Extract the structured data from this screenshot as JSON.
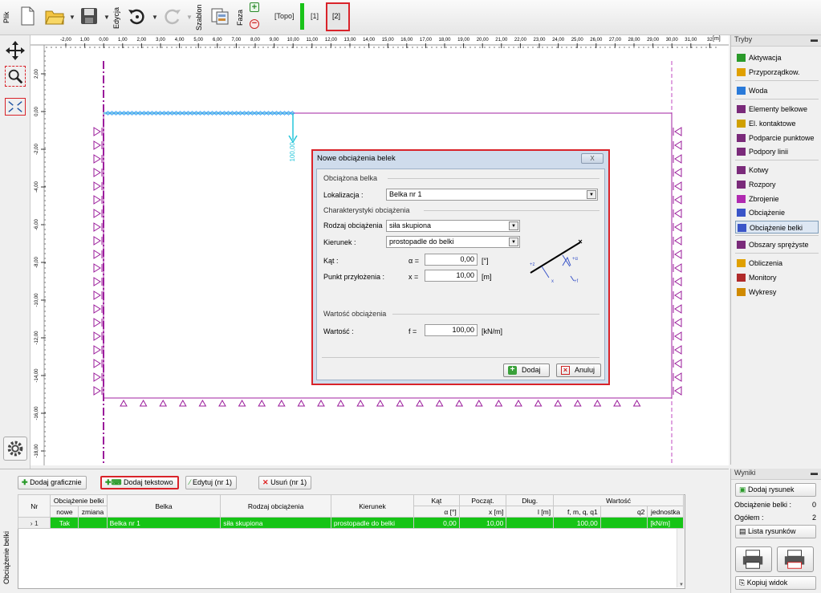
{
  "toolbar": {
    "plik": "Plik",
    "edycja": "Edycja",
    "szablon": "Szablon",
    "faza": "Faza",
    "stages": [
      "[Topo]",
      "[1]",
      "[2]"
    ]
  },
  "ruler": {
    "unit": "[m]",
    "xticks": [
      "-2,00",
      "1,00",
      "0,00",
      "1,00",
      "2,00",
      "3,00",
      "4,00",
      "5,00",
      "6,00",
      "7,00",
      "8,00",
      "9,00",
      "10,00",
      "11,00",
      "12,00",
      "13,00",
      "14,00",
      "15,00",
      "16,00",
      "17,00",
      "18,00",
      "19,00",
      "20,00",
      "21,00",
      "22,00",
      "23,00",
      "24,00",
      "25,00",
      "26,00",
      "27,00",
      "28,00",
      "29,00",
      "30,00",
      "31,00",
      "32"
    ],
    "yticks": [
      "2,00",
      "0,00",
      "-2,00",
      "-4,00",
      "-6,00",
      "-8,00",
      "-10,00",
      "-12,00",
      "-14,00",
      "-16,00",
      "-18,00"
    ]
  },
  "canvas": {
    "load_label": "100,00"
  },
  "right_panel": {
    "title": "Tryby",
    "items": [
      {
        "label": "Aktywacja",
        "icon": "activation-icon"
      },
      {
        "label": "Przyporządkow.",
        "icon": "assign-icon"
      },
      {
        "label": "Woda",
        "icon": "water-icon"
      },
      {
        "label": "Elementy belkowe",
        "icon": "beam-elements-icon"
      },
      {
        "label": "El. kontaktowe",
        "icon": "contact-elements-icon"
      },
      {
        "label": "Podparcie punktowe",
        "icon": "point-support-icon"
      },
      {
        "label": "Podpory linii",
        "icon": "line-support-icon"
      },
      {
        "label": "Kotwy",
        "icon": "anchors-icon"
      },
      {
        "label": "Rozpory",
        "icon": "struts-icon"
      },
      {
        "label": "Zbrojenie",
        "icon": "reinforcement-icon"
      },
      {
        "label": "Obciążenie",
        "icon": "load-icon"
      },
      {
        "label": "Obciążenie belki",
        "icon": "beam-load-icon"
      },
      {
        "label": "Obszary sprężyste",
        "icon": "elastic-areas-icon"
      },
      {
        "label": "Obliczenia",
        "icon": "calculation-icon"
      },
      {
        "label": "Monitory",
        "icon": "monitors-icon"
      },
      {
        "label": "Wykresy",
        "icon": "graphs-icon"
      }
    ]
  },
  "dialog": {
    "title": "Nowe obciążenia belek",
    "group1": "Obciążona belka",
    "lokalizacja_label": "Lokalizacja :",
    "lokalizacja_value": "Belka nr 1",
    "group2": "Charakterystyki obciążenia",
    "rodzaj_label": "Rodzaj obciążenia",
    "rodzaj_value": "siła skupiona",
    "kierunek_label": "Kierunek :",
    "kierunek_value": "prostopadle do belki",
    "kat_label": "Kąt :",
    "kat_sym": "α =",
    "kat_value": "0,00",
    "kat_unit": "[°]",
    "punkt_label": "Punkt przyłożenia :",
    "punkt_sym": "x =",
    "punkt_value": "10,00",
    "punkt_unit": "[m]",
    "group3": "Wartość obciążenia",
    "wartosc_label": "Wartość :",
    "wartosc_sym": "f =",
    "wartosc_value": "100,00",
    "wartosc_unit": "[kN/m]",
    "add": "Dodaj",
    "cancel": "Anuluj",
    "close": "X"
  },
  "bottom": {
    "side_label": "Obciążenie belki",
    "buttons": {
      "add_graphic": "Dodaj graficznie",
      "add_text": "Dodaj tekstowo",
      "edit": "Edytuj (nr 1)",
      "delete": "Usuń (nr 1)"
    },
    "table": {
      "head1": [
        "Nr",
        "Obciążenie belki",
        "Belka",
        "Rodzaj obciążenia",
        "Kierunek",
        "Kąt",
        "Począt.",
        "Dług.",
        "Wartość"
      ],
      "head2": [
        "nowe",
        "zmiana",
        "α [°]",
        "x [m]",
        "l [m]",
        "f, m, q, q1",
        "q2",
        "jednostka"
      ],
      "rows": [
        {
          "nr": "1",
          "nowe": "Tak",
          "zmiana": "",
          "belka": "Belka nr 1",
          "rodzaj": "siła skupiona",
          "kierunek": "prostopadle do belki",
          "kat": "0,00",
          "x": "10,00",
          "l": "",
          "f": "100,00",
          "q2": "",
          "jednostka": "[kN/m]"
        }
      ]
    }
  },
  "results": {
    "title": "Wyniki",
    "add_drawing": "Dodaj rysunek",
    "beam_load_label": "Obciążenie belki :",
    "beam_load_value": "0",
    "total_label": "Ogółem :",
    "total_value": "2",
    "list": "Lista rysunków",
    "copy": "Kopiuj widok"
  }
}
